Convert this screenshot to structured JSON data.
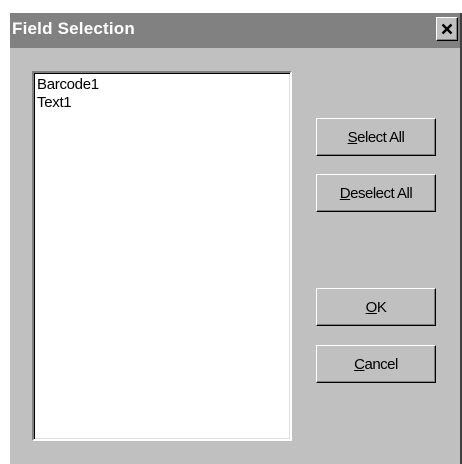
{
  "dialog": {
    "title": "Field Selection",
    "close_icon": "close-icon"
  },
  "field_list": {
    "items": [
      "Barcode1",
      "Text1"
    ]
  },
  "buttons": {
    "select_all": {
      "mnemonic": "S",
      "rest": "elect All"
    },
    "deselect_all": {
      "mnemonic": "D",
      "rest": "eselect All"
    },
    "ok": {
      "mnemonic": "O",
      "rest": "K"
    },
    "cancel": {
      "mnemonic": "C",
      "rest": "ancel"
    }
  }
}
